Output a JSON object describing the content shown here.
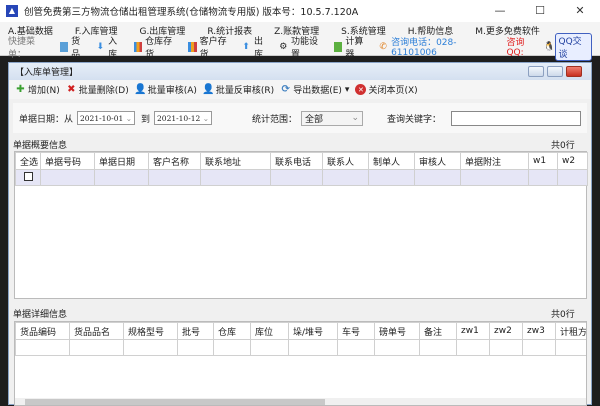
{
  "window": {
    "title": "创管免费第三方物流仓储出租管理系统(仓储物流专用版) 版本号：10.5.7.120A",
    "minimize": "—",
    "maximize": "☐",
    "close": "✕"
  },
  "menu": [
    "A.基础数据",
    "F.入库管理",
    "G.出库管理",
    "R.统计报表",
    "Z.账款管理",
    "S.系统管理",
    "H.帮助信息",
    "M.更多免费软件"
  ],
  "quickbar": {
    "label": "快捷菜单：",
    "items": [
      "货品",
      "入库",
      "仓库存货",
      "客户存货",
      "出库",
      "功能设置",
      "计算器"
    ],
    "phone": "咨询电话：028-61101006",
    "qq_label": "咨询QQ:",
    "qq_button": "QQ交谈"
  },
  "child": {
    "title": "【入库单管理】",
    "toolbar": [
      "增加(N)",
      "批量删除(D)",
      "批量审核(A)",
      "批量反审核(R)",
      "导出数据(E)",
      "关闭本页(X)"
    ],
    "filter": {
      "date_label": "单据日期：从",
      "date_from": "2021-10-01",
      "to_label": "到",
      "date_to": "2021-10-12",
      "range_label": "统计范围：",
      "range_value": "全部",
      "keyword_label": "查询关键字：",
      "keyword_value": ""
    },
    "summary": {
      "label": "单据概要信息",
      "count": "共0行",
      "columns": [
        "全选",
        "单据号码",
        "单据日期",
        "客户名称",
        "联系地址",
        "联系电话",
        "联系人",
        "制单人",
        "审核人",
        "单据附注",
        "w1",
        "w2"
      ]
    },
    "detail": {
      "label": "单据详细信息",
      "count": "共0行",
      "columns": [
        "货品编码",
        "货品品名",
        "规格型号",
        "批号",
        "仓库",
        "库位",
        "垛/堆号",
        "车号",
        "磅单号",
        "备注",
        "zw1",
        "zw2",
        "zw3",
        "计租方式"
      ]
    }
  },
  "colors": {
    "accent": "#2d7fd8",
    "phone": "#2d7fd8",
    "qq": "#e02020"
  }
}
